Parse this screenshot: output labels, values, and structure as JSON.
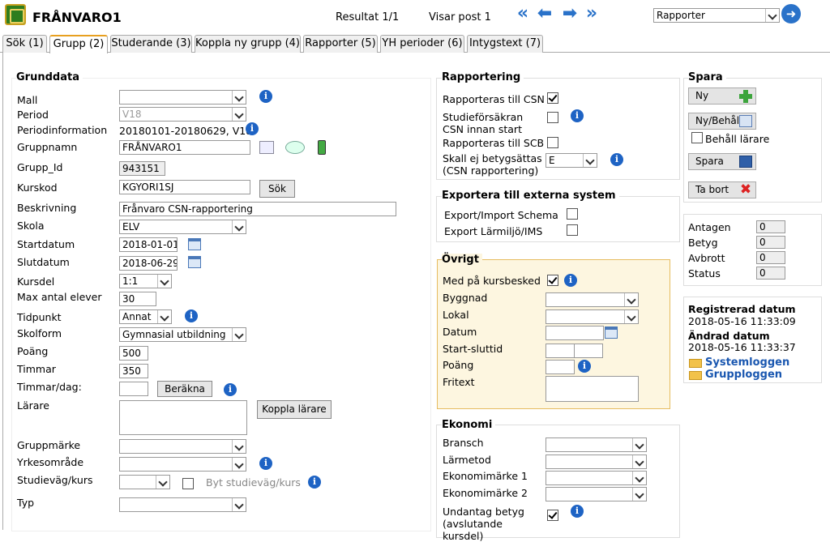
{
  "app": {
    "title": "FRÅNVARO1",
    "result": "Resultat 1/1",
    "showing": "Visar post 1",
    "report_select": "Rapporter"
  },
  "tabs": [
    "Sök (1)",
    "Grupp (2)",
    "Studerande (3)",
    "Koppla ny grupp (4)",
    "Rapporter (5)",
    "YH perioder (6)",
    "Intygstext (7)"
  ],
  "grunddata": {
    "title": "Grunddata",
    "labels": {
      "mall": "Mall",
      "period": "Period",
      "periodinfo": "Periodinformation",
      "gruppnamn": "Gruppnamn",
      "grupp_id": "Grupp_Id",
      "kurskod": "Kurskod",
      "beskrivning": "Beskrivning",
      "skola": "Skola",
      "startdatum": "Startdatum",
      "slutdatum": "Slutdatum",
      "kursdel": "Kursdel",
      "max": "Max antal elever",
      "tidpunkt": "Tidpunkt",
      "skolform": "Skolform",
      "poang": "Poäng",
      "timmar": "Timmar",
      "timmar_dag": "Timmar/dag:",
      "larare": "Lärare",
      "gruppmarke": "Gruppmärke",
      "yrkesomrade": "Yrkesområde",
      "studievag": "Studieväg/kurs",
      "typ": "Typ"
    },
    "values": {
      "mall": "",
      "period": "V18",
      "periodinfo": "20180101-20180629, V18",
      "gruppnamn": "FRÅNVARO1",
      "grupp_id": "943151",
      "kurskod": "KGYORI1SJ",
      "beskrivning": "Frånvaro CSN-rapportering",
      "skola": "ELV",
      "startdatum": "2018-01-01",
      "slutdatum": "2018-06-29",
      "kursdel": "1:1",
      "max": "30",
      "tidpunkt": "Annat",
      "skolform": "Gymnasial utbildning",
      "poang": "500",
      "timmar": "350",
      "timmar_dag": ""
    },
    "buttons": {
      "sok": "Sök",
      "berakna": "Beräkna",
      "koppla": "Koppla lärare"
    },
    "byt_studievag": "Byt studieväg/kurs"
  },
  "rapportering": {
    "title": "Rapportering",
    "csn": "Rapporteras till CSN",
    "studieforsakran": "Studieförsäkran CSN innan start",
    "scb": "Rapporteras till SCB",
    "betyg_label": "Skall ej betygsättas (CSN rapportering)",
    "betyg_value": "E"
  },
  "exportera": {
    "title": "Exportera till externa system",
    "schema": "Export/Import Schema",
    "larmiljo": "Export Lärmiljö/IMS"
  },
  "ovrigt": {
    "title": "Övrigt",
    "kursbesked": "Med på kursbesked",
    "byggnad": "Byggnad",
    "lokal": "Lokal",
    "datum": "Datum",
    "start_slut": "Start-sluttid",
    "poang": "Poäng",
    "fritext": "Fritext"
  },
  "ekonomi": {
    "title": "Ekonomi",
    "bransch": "Bransch",
    "larmetod": "Lärmetod",
    "ekm1": "Ekonomimärke 1",
    "ekm2": "Ekonomimärke 2",
    "undantag": "Undantag betyg (avslutande kursdel)"
  },
  "spara": {
    "title": "Spara",
    "ny": "Ny",
    "ny_behall": "Ny/Behåll",
    "behall_larare": "Behåll lärare",
    "spara": "Spara",
    "ta_bort": "Ta bort"
  },
  "stats": {
    "antagen": "Antagen",
    "betyg": "Betyg",
    "avbrott": "Avbrott",
    "status": "Status",
    "antagen_v": "0",
    "betyg_v": "0",
    "avbrott_v": "0",
    "status_v": "0"
  },
  "meta": {
    "registrerad_label": "Registrerad datum",
    "registrerad": "2018-05-16 11:33:09",
    "andrad_label": "Ändrad datum",
    "andrad": "2018-05-16 11:33:37",
    "systemloggen": "Systemloggen",
    "grupploggen": "Grupploggen"
  }
}
